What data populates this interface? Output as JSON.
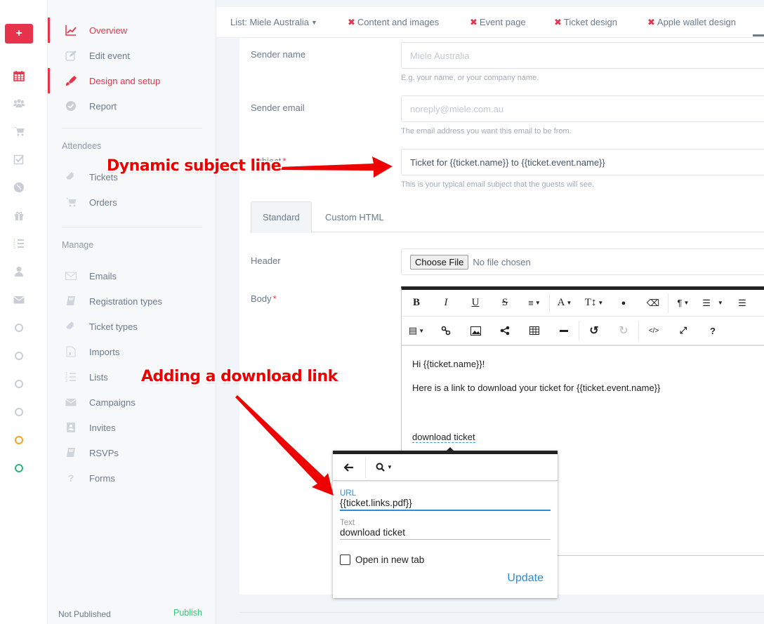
{
  "rail": {
    "add_label": "+",
    "icons": [
      "calendar-icon",
      "users-icon",
      "cart-icon",
      "checkbox-icon",
      "globe-icon",
      "gift-icon",
      "ordered-list-icon",
      "user-icon",
      "envelope-icon"
    ],
    "status_circles": [
      {
        "name": "status-circle-1",
        "color": "#c9ced6"
      },
      {
        "name": "status-circle-2",
        "color": "#c9ced6"
      },
      {
        "name": "status-circle-3",
        "color": "#c9ced6"
      },
      {
        "name": "status-circle-4",
        "color": "#c9ced6"
      },
      {
        "name": "status-circle-5",
        "color": "#f5a623"
      },
      {
        "name": "status-circle-6",
        "color": "#2bb673"
      }
    ]
  },
  "nav": {
    "main_items": [
      {
        "label": "Overview",
        "icon": "line-chart-icon",
        "active": true
      },
      {
        "label": "Edit event",
        "icon": "edit-icon",
        "active": false
      },
      {
        "label": "Design and setup",
        "icon": "paint-brush-icon",
        "active": true
      },
      {
        "label": "Report",
        "icon": "check-circle-icon",
        "active": false
      }
    ],
    "attendees_heading": "Attendees",
    "attendees_items": [
      {
        "label": "Tickets",
        "icon": "ticket-icon"
      },
      {
        "label": "Orders",
        "icon": "cart-icon"
      }
    ],
    "manage_heading": "Manage",
    "manage_items": [
      {
        "label": "Emails",
        "icon": "envelope-outline-icon"
      },
      {
        "label": "Registration types",
        "icon": "book-icon"
      },
      {
        "label": "Ticket types",
        "icon": "ticket-icon"
      },
      {
        "label": "Imports",
        "icon": "excel-file-icon"
      },
      {
        "label": "Lists",
        "icon": "ordered-list-icon"
      },
      {
        "label": "Campaigns",
        "icon": "envelope-icon"
      },
      {
        "label": "Invites",
        "icon": "address-book-icon"
      },
      {
        "label": "RSVPs",
        "icon": "book-icon"
      },
      {
        "label": "Forms",
        "icon": "question-icon"
      }
    ],
    "footer_status": "Not Published",
    "footer_action": "Publish"
  },
  "topbar": {
    "list_selector": "List: Miele Australia",
    "items": [
      "Content and images",
      "Event page",
      "Ticket design",
      "Apple wallet design"
    ]
  },
  "form": {
    "sender_name": {
      "label": "Sender name",
      "placeholder": "Miele Australia",
      "help": "E.g. your name, or your company name."
    },
    "sender_email": {
      "label": "Sender email",
      "placeholder": "noreply@miele.com.au",
      "help": "The email address you want this email to be from."
    },
    "subject": {
      "label": "Subject",
      "required_mark": "*",
      "value": "Ticket for {{ticket.name}} to {{ticket.event.name}}",
      "help": "This is your typical email subject that the guests will see."
    },
    "tabs": [
      {
        "label": "Standard",
        "active": true
      },
      {
        "label": "Custom HTML",
        "active": false
      }
    ],
    "header": {
      "label": "Header",
      "button": "Choose File",
      "status": "No file chosen"
    },
    "body": {
      "label": "Body",
      "required_mark": "*"
    }
  },
  "editor": {
    "toolbar_row1": [
      {
        "name": "bold-button",
        "glyph": "B"
      },
      {
        "name": "italic-button",
        "glyph": "I"
      },
      {
        "name": "underline-button",
        "glyph": "U"
      },
      {
        "name": "strikethrough-button",
        "glyph": "S"
      },
      {
        "name": "align-button",
        "glyph": "≡"
      },
      {
        "name": "font-color-button",
        "glyph": "A"
      },
      {
        "name": "font-size-button",
        "glyph": "T↕"
      },
      {
        "name": "color-drop-button",
        "glyph": "●"
      },
      {
        "name": "eraser-button",
        "glyph": "⌫"
      },
      {
        "name": "paragraph-button",
        "glyph": "¶"
      },
      {
        "name": "ordered-list-button",
        "glyph": "☰"
      },
      {
        "name": "unordered-list-button",
        "glyph": "☰"
      }
    ],
    "toolbar_row2": [
      {
        "name": "template-button",
        "glyph": "▤"
      },
      {
        "name": "link-button",
        "glyph": "🔗"
      },
      {
        "name": "image-button",
        "glyph": "▨"
      },
      {
        "name": "share-button",
        "glyph": "<"
      },
      {
        "name": "table-button",
        "glyph": "▦"
      },
      {
        "name": "hr-button",
        "glyph": "—"
      },
      {
        "name": "undo-button",
        "glyph": "↺"
      },
      {
        "name": "redo-button",
        "glyph": "↻"
      },
      {
        "name": "code-view-button",
        "glyph": "</>"
      },
      {
        "name": "fullscreen-button",
        "glyph": "⤢"
      },
      {
        "name": "help-button",
        "glyph": "?"
      }
    ],
    "content": {
      "greeting": "Hi {{ticket.name}}!",
      "line2": "Here is a link to download your ticket for {{ticket.event.name}}",
      "link_text": "download ticket"
    }
  },
  "link_popover": {
    "url_label": "URL",
    "url_value": "{{ticket.links.pdf}}",
    "text_label": "Text",
    "text_value": "download ticket",
    "new_tab_label": "Open in new tab",
    "new_tab_checked": false,
    "update_label": "Update"
  },
  "annotations": {
    "subject": "Dynamic subject line",
    "download": "Adding a download link",
    "color": "#ee0000"
  }
}
